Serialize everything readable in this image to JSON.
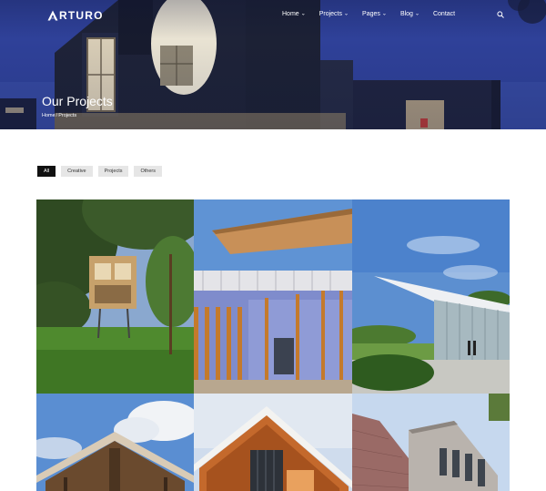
{
  "brand": {
    "logo_text": "RTURO",
    "logo_mark": "A"
  },
  "nav": {
    "items": [
      {
        "label": "Home",
        "has_dropdown": true
      },
      {
        "label": "Projects",
        "has_dropdown": true
      },
      {
        "label": "Pages",
        "has_dropdown": true
      },
      {
        "label": "Blog",
        "has_dropdown": true
      },
      {
        "label": "Contact",
        "has_dropdown": false
      }
    ],
    "search_icon": "search-icon"
  },
  "hero": {
    "title": "Our Projects",
    "breadcrumb": {
      "home": "Home",
      "separator": "/",
      "current": "Projects"
    }
  },
  "filters": {
    "items": [
      "All",
      "Creative",
      "Projects",
      "Others"
    ],
    "active": "All"
  },
  "colors": {
    "hero_sky": "#31439a",
    "filter_active_bg": "#111111",
    "filter_bg": "#e6e6e6"
  },
  "projects": {
    "tiles": [
      {
        "name": "treehouse-forest"
      },
      {
        "name": "curved-pavilion"
      },
      {
        "name": "glass-wing-building"
      },
      {
        "name": "gable-roof-house"
      },
      {
        "name": "timber-roof-house"
      },
      {
        "name": "brick-gable-building"
      }
    ]
  }
}
